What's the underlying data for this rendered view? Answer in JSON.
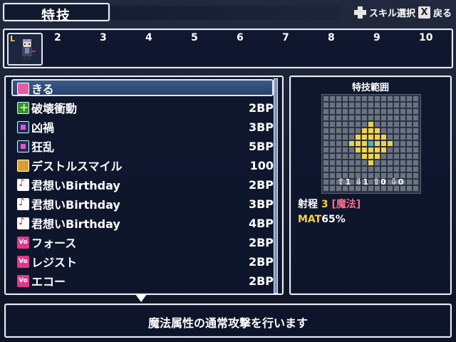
{
  "header": {
    "title": "特技",
    "skill_select_label": "スキル選択",
    "back_label": "戻る",
    "back_button_glyph": "X"
  },
  "party": {
    "leader_marker": "L",
    "slot_numbers": [
      "2",
      "3",
      "4",
      "5",
      "6",
      "7",
      "8",
      "9",
      "10"
    ]
  },
  "skills": [
    {
      "name": "きる",
      "cost": "",
      "icon": "pink-sword-icon"
    },
    {
      "name": "破壊衝動",
      "cost": "2BP",
      "icon": "green-plus-icon"
    },
    {
      "name": "凶禍",
      "cost": "3BP",
      "icon": "blue-square-icon"
    },
    {
      "name": "狂乱",
      "cost": "5BP",
      "icon": "blue-square-icon"
    },
    {
      "name": "デストルスマイル",
      "cost": "100",
      "icon": "gold-pattern-icon"
    },
    {
      "name": "君想いBirthday",
      "cost": "2BP",
      "icon": "music-note-icon"
    },
    {
      "name": "君想いBirthday",
      "cost": "3BP",
      "icon": "music-note-icon"
    },
    {
      "name": "君想いBirthday",
      "cost": "4BP",
      "icon": "music-note-icon"
    },
    {
      "name": "フォース",
      "cost": "2BP",
      "icon": "vo-icon"
    },
    {
      "name": "レジスト",
      "cost": "2BP",
      "icon": "vo-icon"
    },
    {
      "name": "エコー",
      "cost": "2BP",
      "icon": "vo-icon"
    }
  ],
  "range": {
    "title": "特技範囲",
    "stats": [
      "1",
      "1",
      "0",
      "0"
    ],
    "range_label": "射程",
    "range_value": "3",
    "type_open": "[",
    "type": "魔法",
    "type_close": "]",
    "mat_label": "MAT",
    "mat_value": "65%"
  },
  "description": "魔法属性の通常攻撃を行います",
  "colors": {
    "accent_yellow": "#f1d24a",
    "cursor_blue": "#3c5b8a",
    "panel_bg": "#0e162c"
  }
}
